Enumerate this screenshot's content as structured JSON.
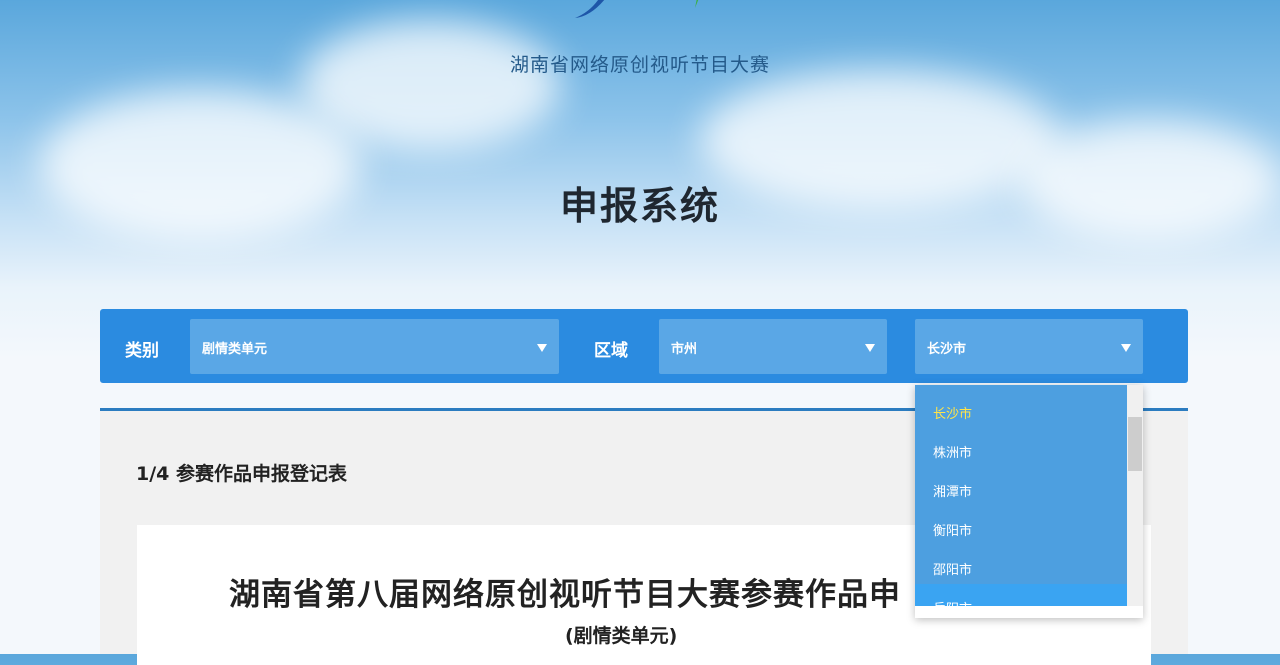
{
  "header": {
    "site_title": "湖南省网络原创视听节目大赛",
    "system_title": "申报系统"
  },
  "filters": {
    "category_label": "类别",
    "category_value": "剧情类单元",
    "region_label": "区域",
    "region_type_value": "市州",
    "city_value": "长沙市"
  },
  "city_dropdown": {
    "options": [
      "长沙市",
      "株洲市",
      "湘潭市",
      "衡阳市",
      "邵阳市",
      "岳阳市"
    ],
    "selected_color": "#ffe44a"
  },
  "main": {
    "step_title": "1/4 参赛作品申报登记表",
    "form_title": "湖南省第八届网络原创视听节目大赛参赛作品申",
    "form_subtitle": "(剧情类单元)"
  },
  "colors": {
    "accent": "#2b8be0",
    "select_bg": "#5aa7e6",
    "divider": "#2b7cc0"
  }
}
